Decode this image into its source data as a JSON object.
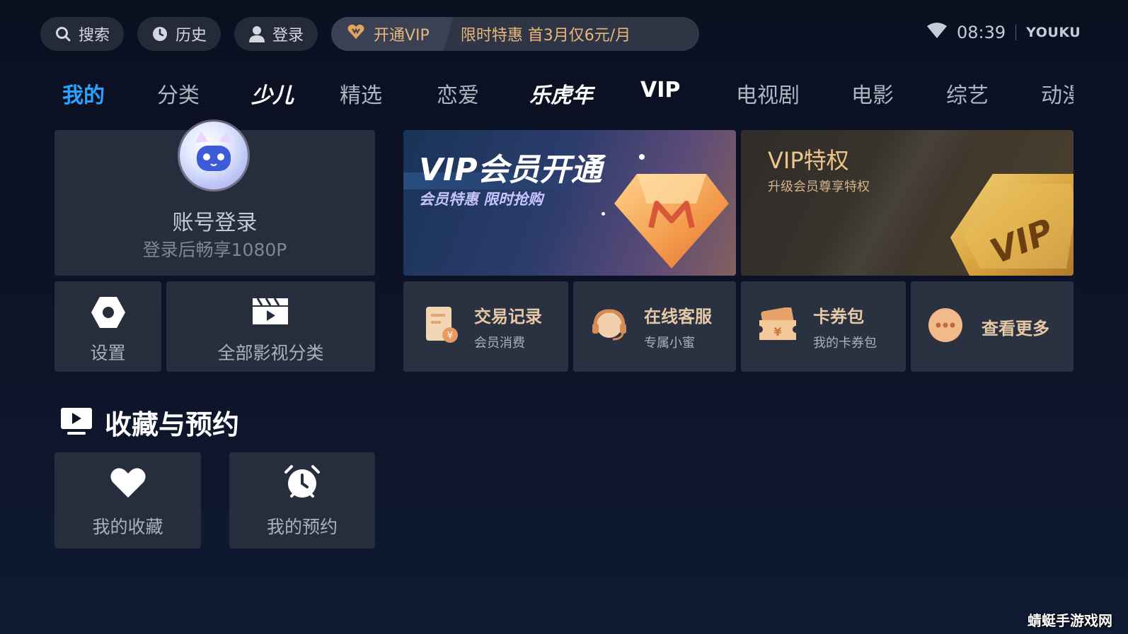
{
  "topbar": {
    "search_label": "搜索",
    "history_label": "历史",
    "login_label": "登录",
    "vip_button_label": "开通VIP",
    "vip_promo_text": "限时特惠 首3月仅6元/月",
    "time": "08:39",
    "brand": "YOUKU"
  },
  "nav": {
    "items": [
      "我的",
      "分类",
      "少儿",
      "精选",
      "恋爱",
      "乐虎年",
      "VIP",
      "电视剧",
      "电影",
      "综艺",
      "动漫"
    ]
  },
  "account": {
    "title": "账号登录",
    "subtitle": "登录后畅享1080P"
  },
  "shortcuts": {
    "settings_label": "设置",
    "categories_label": "全部影视分类"
  },
  "promos": {
    "vip_title": "VIP会员开通",
    "vip_subtitle": "会员特惠 限时抢购",
    "privilege_title": "VIP特权",
    "privilege_subtitle": "升级会员尊享特权",
    "badge_text": "VIP"
  },
  "services": [
    {
      "title": "交易记录",
      "subtitle": "会员消费",
      "icon": "receipt-icon"
    },
    {
      "title": "在线客服",
      "subtitle": "专属小蜜",
      "icon": "headset-icon"
    },
    {
      "title": "卡券包",
      "subtitle": "我的卡券包",
      "icon": "coupon-icon"
    },
    {
      "title": "查看更多",
      "icon": "more-icon"
    }
  ],
  "favorites": {
    "section_title": "收藏与预约",
    "collection_label": "我的收藏",
    "reservation_label": "我的预约"
  },
  "watermark": "蜻蜓手游戏网",
  "colors": {
    "accent": "#2aa2ff",
    "gold": "#e8b77c",
    "card": "#262d3d"
  }
}
